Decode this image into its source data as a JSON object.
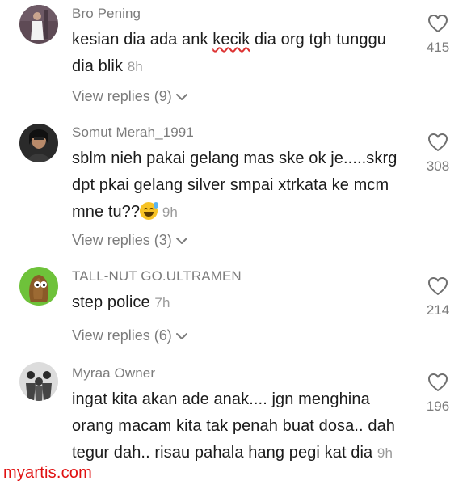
{
  "comments": [
    {
      "username": "Bro Pening",
      "text_before": "kesian dia ada ank ",
      "text_flagged": "kecik",
      "text_after": " dia org tgh tunggu dia blik",
      "time": "8h",
      "replies": "View replies (9)",
      "likes": "415",
      "avatar": "person-white-outfit"
    },
    {
      "username": "Somut Merah_1991",
      "text": "sblm nieh pakai gelang mas ske ok je.....skrg dpt pkai gelang silver smpai xtrkata ke mcm mne tu??",
      "emoji": "grinning-face-with-sweat",
      "time": "9h",
      "replies": "View replies (3)",
      "likes": "308",
      "avatar": "person-portrait"
    },
    {
      "username": "TALL-NUT GO.ULTRAMEN",
      "text": "step police",
      "time": "7h",
      "replies": "View replies (6)",
      "likes": "214",
      "avatar": "tall-nut-character"
    },
    {
      "username": "Myraa Owner",
      "text": "ingat kita akan ade anak.... jgn menghina orang macam kita tak penah buat dosa.. dah tegur dah.. risau pahala hang pegi kat dia",
      "time": "9h",
      "likes": "196",
      "avatar": "group-photo"
    }
  ],
  "watermark": "myartis.com",
  "colors": {
    "watermark": "#e01010",
    "meta": "#7c7c7c",
    "text": "#1b1b1b"
  }
}
